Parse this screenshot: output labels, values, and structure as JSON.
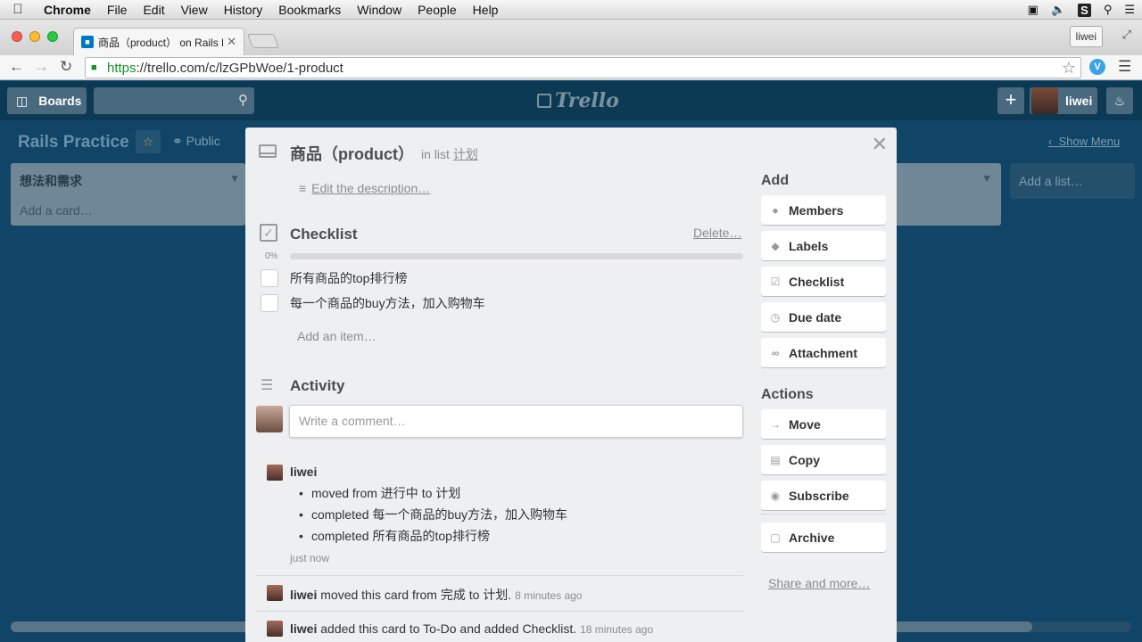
{
  "menubar": {
    "app": "Chrome",
    "items": [
      "File",
      "Edit",
      "View",
      "History",
      "Bookmarks",
      "Window",
      "People",
      "Help"
    ]
  },
  "browser": {
    "tab_title": "商品（product） on Rails P",
    "profile": "liwei",
    "url_scheme": "https",
    "url_rest": "://trello.com/c/lzGPbWoe/1-product"
  },
  "trello": {
    "boards_label": "Boards",
    "logo": "Trello",
    "username": "liwei",
    "board_title": "Rails Practice",
    "visibility": "Public",
    "show_menu": "Show Menu",
    "list1_name": "想法和需求",
    "list1_add_card": "Add a card…",
    "add_list": "Add a list…"
  },
  "card": {
    "title": "商品（product）",
    "in_list_prefix": "in list",
    "list_name": "计划",
    "edit_description": "Edit the description…",
    "checklist": {
      "title": "Checklist",
      "delete": "Delete…",
      "progress_label": "0%",
      "progress": 0,
      "items": [
        "所有商品的top排行榜",
        "每一个商品的buy方法，加入购物车"
      ],
      "add_item": "Add an item…"
    },
    "activity": {
      "title": "Activity",
      "comment_placeholder": "Write a comment…",
      "group_user": "liwei",
      "group_items": [
        "moved from 进行中 to 计划",
        "completed 每一个商品的buy方法，加入购物车",
        "completed 所有商品的top排行榜"
      ],
      "group_time": "just now",
      "entry1_user": "liwei",
      "entry1_text": "moved this card from 完成 to 计划.",
      "entry1_time": "8 minutes ago",
      "entry2_user": "liwei",
      "entry2_text": "added this card to To-Do and added Checklist.",
      "entry2_time": "18 minutes ago"
    }
  },
  "sidebar": {
    "add_heading": "Add",
    "add_buttons": [
      "Members",
      "Labels",
      "Checklist",
      "Due date",
      "Attachment"
    ],
    "actions_heading": "Actions",
    "action_buttons": [
      "Move",
      "Copy",
      "Subscribe"
    ],
    "archive": "Archive",
    "share_more": "Share and more…"
  },
  "icons": {
    "close": "close-icon",
    "card": "card-icon",
    "checklist": "checklist-icon",
    "activity": "activity-icon"
  },
  "colors": {
    "board_bg": "#1a4f7c",
    "header_bg": "#0c3953",
    "modal_bg": "#edeff0",
    "https_green": "#1a8d2e"
  }
}
